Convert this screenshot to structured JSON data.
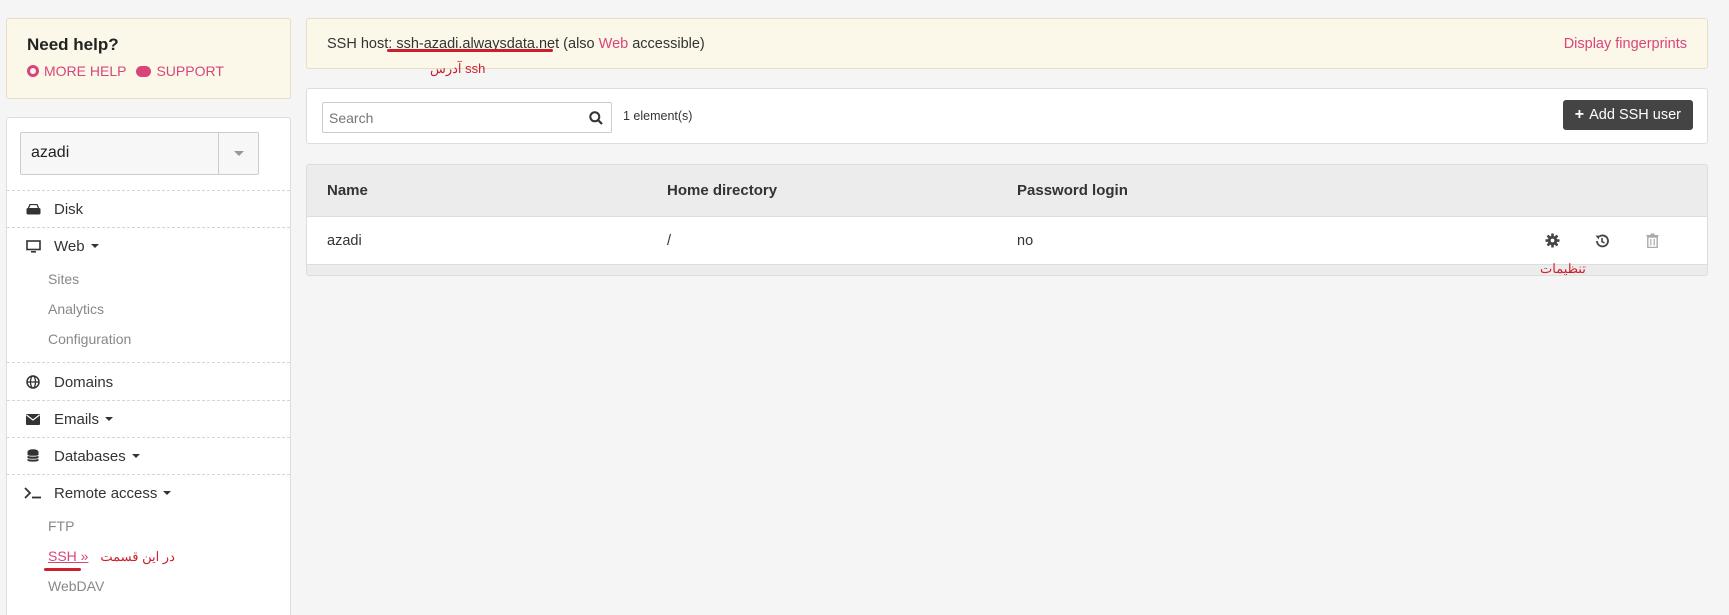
{
  "help": {
    "title": "Need help?",
    "more_help": "MORE HELP",
    "support": "SUPPORT"
  },
  "account": {
    "selected": "azadi"
  },
  "nav": {
    "disk": "Disk",
    "web": "Web",
    "web_sub": [
      "Sites",
      "Analytics",
      "Configuration"
    ],
    "domains": "Domains",
    "emails": "Emails",
    "databases": "Databases",
    "remote": "Remote access",
    "remote_sub": {
      "ftp": "FTP",
      "ssh": "SSH »",
      "webdav": "WebDAV"
    }
  },
  "annotations": {
    "ssh_menu": "در این قسمت",
    "ssh_address": "آدرس ssh",
    "settings": "تنظیمات"
  },
  "hostbar": {
    "prefix": "SSH host:",
    "host": "ssh-azadi.alwaysdata.net",
    "also": "(also",
    "web": "Web",
    "accessible": "accessible)",
    "fingerprints": "Display fingerprints"
  },
  "toolbar": {
    "search_placeholder": "Search",
    "count": "1 element(s)",
    "add_label": "Add SSH user"
  },
  "table": {
    "headers": [
      "Name",
      "Home directory",
      "Password login"
    ],
    "rows": [
      {
        "name": "azadi",
        "home": "/",
        "password_login": "no"
      }
    ]
  },
  "colors": {
    "accent": "#d9457a",
    "annotation": "#cc1f2d",
    "button": "#444444"
  },
  "icons": [
    "error-circle-icon",
    "chat-icon",
    "hdd-icon",
    "monitor-icon",
    "globe-icon",
    "envelope-icon",
    "database-icon",
    "terminal-icon",
    "search-icon",
    "plus-icon",
    "gear-icon",
    "history-icon",
    "trash-icon"
  ]
}
